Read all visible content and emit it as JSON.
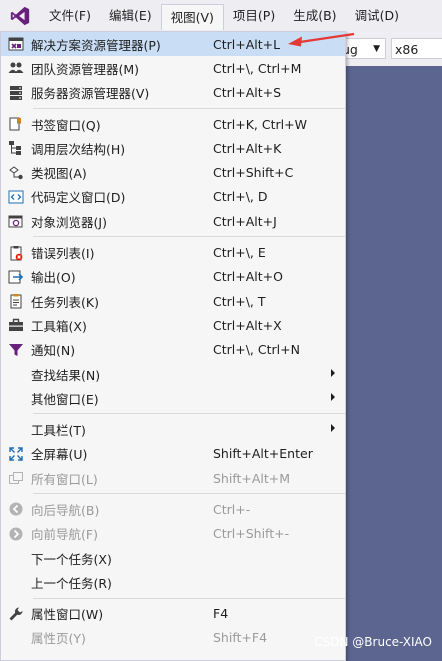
{
  "menubar": {
    "items": [
      {
        "label": "文件(F)"
      },
      {
        "label": "编辑(E)"
      },
      {
        "label": "视图(V)"
      },
      {
        "label": "项目(P)"
      },
      {
        "label": "生成(B)"
      },
      {
        "label": "调试(D)"
      }
    ]
  },
  "toolbar": {
    "config_value": "ug",
    "platform_value": "x86"
  },
  "menu": {
    "items": [
      {
        "label": "解决方案资源管理器(P)",
        "shortcut": "Ctrl+Alt+L",
        "icon": "solution-explorer-icon"
      },
      {
        "label": "团队资源管理器(M)",
        "shortcut": "Ctrl+\\, Ctrl+M",
        "icon": "team-explorer-icon"
      },
      {
        "label": "服务器资源管理器(V)",
        "shortcut": "Ctrl+Alt+S",
        "icon": "server-explorer-icon"
      },
      {
        "label": "书签窗口(Q)",
        "shortcut": "Ctrl+K, Ctrl+W",
        "icon": "bookmark-icon"
      },
      {
        "label": "调用层次结构(H)",
        "shortcut": "Ctrl+Alt+K",
        "icon": "call-hierarchy-icon"
      },
      {
        "label": "类视图(A)",
        "shortcut": "Ctrl+Shift+C",
        "icon": "class-view-icon"
      },
      {
        "label": "代码定义窗口(D)",
        "shortcut": "Ctrl+\\, D",
        "icon": "code-definition-icon"
      },
      {
        "label": "对象浏览器(J)",
        "shortcut": "Ctrl+Alt+J",
        "icon": "object-browser-icon"
      },
      {
        "label": "错误列表(I)",
        "shortcut": "Ctrl+\\, E",
        "icon": "error-list-icon"
      },
      {
        "label": "输出(O)",
        "shortcut": "Ctrl+Alt+O",
        "icon": "output-icon"
      },
      {
        "label": "任务列表(K)",
        "shortcut": "Ctrl+\\, T",
        "icon": "task-list-icon"
      },
      {
        "label": "工具箱(X)",
        "shortcut": "Ctrl+Alt+X",
        "icon": "toolbox-icon"
      },
      {
        "label": "通知(N)",
        "shortcut": "Ctrl+\\, Ctrl+N",
        "icon": "notification-icon"
      },
      {
        "label": "查找结果(N)",
        "shortcut": "",
        "icon": ""
      },
      {
        "label": "其他窗口(E)",
        "shortcut": "",
        "icon": ""
      },
      {
        "label": "工具栏(T)",
        "shortcut": "",
        "icon": ""
      },
      {
        "label": "全屏幕(U)",
        "shortcut": "Shift+Alt+Enter",
        "icon": "fullscreen-icon"
      },
      {
        "label": "所有窗口(L)",
        "shortcut": "Shift+Alt+M",
        "icon": "all-windows-icon"
      },
      {
        "label": "向后导航(B)",
        "shortcut": "Ctrl+-",
        "icon": "navigate-back-icon"
      },
      {
        "label": "向前导航(F)",
        "shortcut": "Ctrl+Shift+-",
        "icon": "navigate-forward-icon"
      },
      {
        "label": "下一个任务(X)",
        "shortcut": "",
        "icon": ""
      },
      {
        "label": "上一个任务(R)",
        "shortcut": "",
        "icon": ""
      },
      {
        "label": "属性窗口(W)",
        "shortcut": "F4",
        "icon": "wrench-icon"
      },
      {
        "label": "属性页(Y)",
        "shortcut": "Shift+F4",
        "icon": ""
      }
    ]
  },
  "colors": {
    "highlight": "#c9def5",
    "annotation_arrow": "#e53935",
    "background": "#5b6590"
  },
  "watermark": "CSDN @Bruce-XIAO"
}
